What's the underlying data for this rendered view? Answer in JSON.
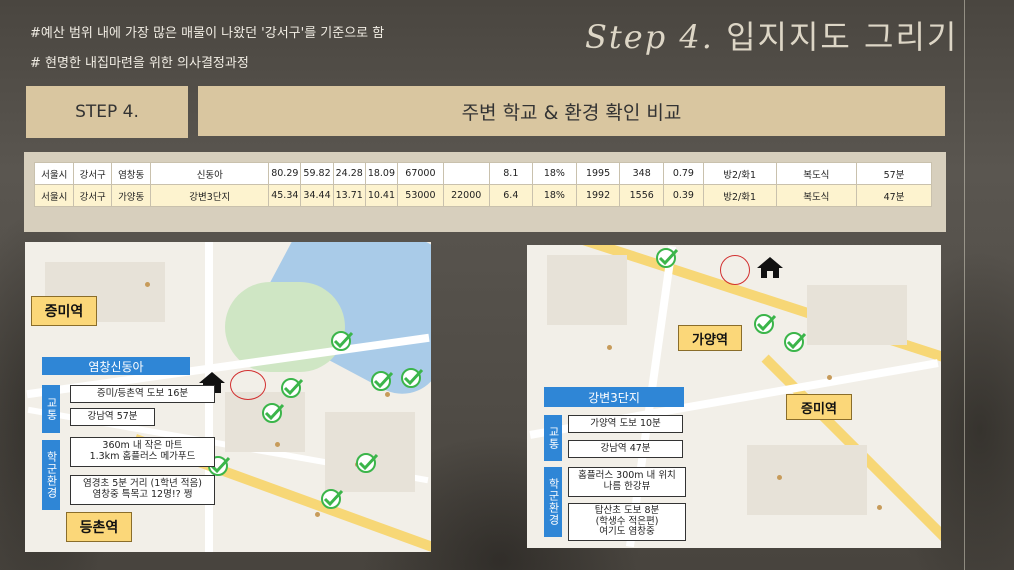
{
  "header": {
    "note_line1": "#예산 범위 내에 가장 많은 매물이 나왔던 '강서구'를 기준으로 함",
    "note_line2": "# 현명한 내집마련을 위한 의사결정과정",
    "title_script": "Step 4.",
    "title_korean": "입지지도 그리기"
  },
  "step_label": "STEP 4.",
  "section_title": "주변 학교 & 환경 확인 비교",
  "table": {
    "rows": [
      [
        "서울시",
        "강서구",
        "염창동",
        "신동아",
        "80.29",
        "59.82",
        "24.28",
        "18.09",
        "67000",
        "",
        "8.1",
        "18%",
        "1995",
        "348",
        "0.79",
        "방2/화1",
        "복도식",
        "57분"
      ],
      [
        "서울시",
        "강서구",
        "가양동",
        "강변3단지",
        "45.34",
        "34.44",
        "13.71",
        "10.41",
        "53000",
        "22000",
        "6.4",
        "18%",
        "1992",
        "1556",
        "0.39",
        "방2/화1",
        "복도식",
        "47분"
      ]
    ]
  },
  "map_left": {
    "station_top": "증미역",
    "station_bottom": "등촌역",
    "panel_title": "염창신동아",
    "tab_transport": "교통",
    "tab_school": "학군환경",
    "info": [
      "증미/등촌역 도보 16분",
      "강남역 57분",
      "360m 내 작은 마트\n1.3km 홈플러스 메가푸드",
      "염경초 5분 거리 (1학년 적음)\n염창중 특목고 12명!? 쩡"
    ]
  },
  "map_right": {
    "station_a": "가양역",
    "station_b": "증미역",
    "panel_title": "강변3단지",
    "tab_transport": "교통",
    "tab_school": "학군환경",
    "info": [
      "가양역 도보 10분",
      "강남역 47분",
      "홈플러스 300m 내 위치\n나름 한강뷰",
      "탑산초 도보 8분\n(학생수 적은편)\n여기도 염창중"
    ]
  },
  "colors": {
    "accent_tan": "#d9c6a0",
    "panel_blue": "#2f86d6",
    "station_yellow": "#fbd779",
    "check_green": "#3bb54a"
  }
}
